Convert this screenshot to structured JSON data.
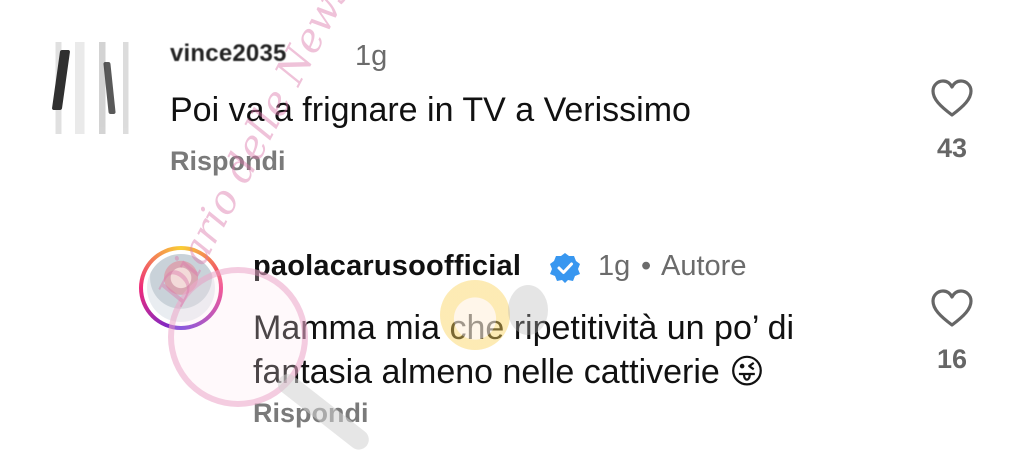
{
  "comments": [
    {
      "username": "vince2035",
      "time": "1g",
      "text": "Poi va a frignare in TV a Verissimo",
      "reply_label": "Rispondi",
      "likes": "43"
    },
    {
      "username": "paolacarusoofficial",
      "time": "1g",
      "separator": "•",
      "role": "Autore",
      "text": "Mamma mia che ripetitività un po’ di fantasia almeno nelle cattiverie 😜",
      "reply_label": "Rispondi",
      "likes": "16"
    }
  ],
  "watermark_text": "Diario delle News",
  "colors": {
    "text": "#111111",
    "secondary": "#6b6b6b",
    "verified": "#3897f0"
  }
}
